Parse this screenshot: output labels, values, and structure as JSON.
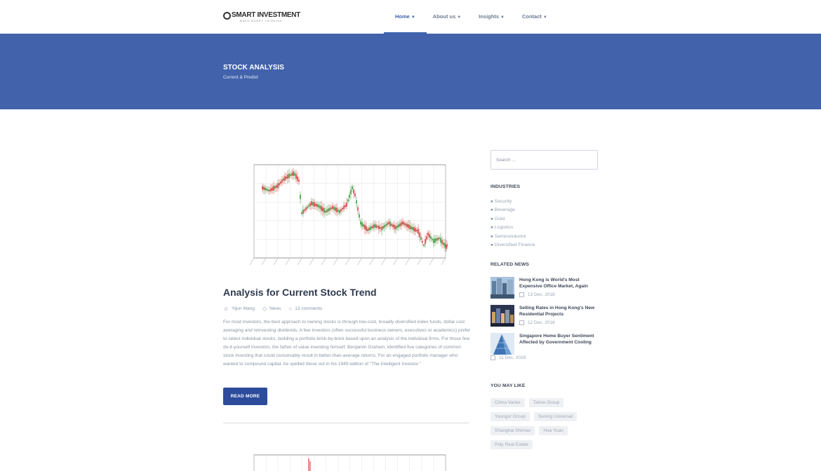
{
  "brand": {
    "name": "SMART INVESTMENT",
    "tagline": "MAKE MONEY THINKING"
  },
  "nav": [
    {
      "label": "Home",
      "active": true
    },
    {
      "label": "About us",
      "active": false
    },
    {
      "label": "Insights",
      "active": false
    },
    {
      "label": "Contact",
      "active": false
    }
  ],
  "hero": {
    "title": "STOCK ANALYSIS",
    "subtitle": "Current & Predict"
  },
  "post": {
    "title": "Analysis for Current Stock Trend",
    "author": "Yijun Wang",
    "category": "News",
    "comments": "13 comments",
    "excerpt": "For most investors, the best approach to owning stocks is through low-cost, broadly diversified index funds, dollar cost averaging and reinvesting dividends. A few investors (often successful business owners, executives or academics) prefer to select individual stocks, building a portfolio brick-by-brick based upon an analysis of the individual firms. For those few do-it-yourself investors, the father of value investing himself, Benjamin Graham, identified five categories of common stock investing that could conceivably result in better-than-average returns. For an engaged portfolio manager who wanted to compound capital, he spelled these out in his 1949 edition of \"The Intelligent Investor.\"",
    "read_more": "READ MORE",
    "icons": {
      "author": "user-icon",
      "category": "tag-icon",
      "comments": "comment-icon"
    }
  },
  "sidebar": {
    "search_placeholder": "Search ...",
    "industries_heading": "INDUSTRIES",
    "industries": [
      "Security",
      "Beverage",
      "Gold",
      "Logistics",
      "Semiconductor",
      "Diversified Finance"
    ],
    "related_heading": "RELATED NEWS",
    "related": [
      {
        "title": "Hong Kong is World's Most Expensive Office Market, Again",
        "date": "13 Dec, 2018"
      },
      {
        "title": "Selling Rates in Hong Kong's New Residential Projects",
        "date": "12 Dec, 2018"
      },
      {
        "title": "Singapore Home Buyer Sentiment Affected by Government Cooling",
        "date": "11 Dec, 2018"
      }
    ],
    "like_heading": "YOU MAY LIKE",
    "tags": [
      "China Vanke",
      "Tahoe Group",
      "Youngor Group",
      "Suning Universal",
      "Shanghai Shimao",
      "Hua Yuan",
      "Poly Real Estate"
    ]
  },
  "colors": {
    "primary": "#4263ab",
    "button": "#2d4b9b",
    "up": "#3a9a3a",
    "down": "#d43b3b"
  }
}
